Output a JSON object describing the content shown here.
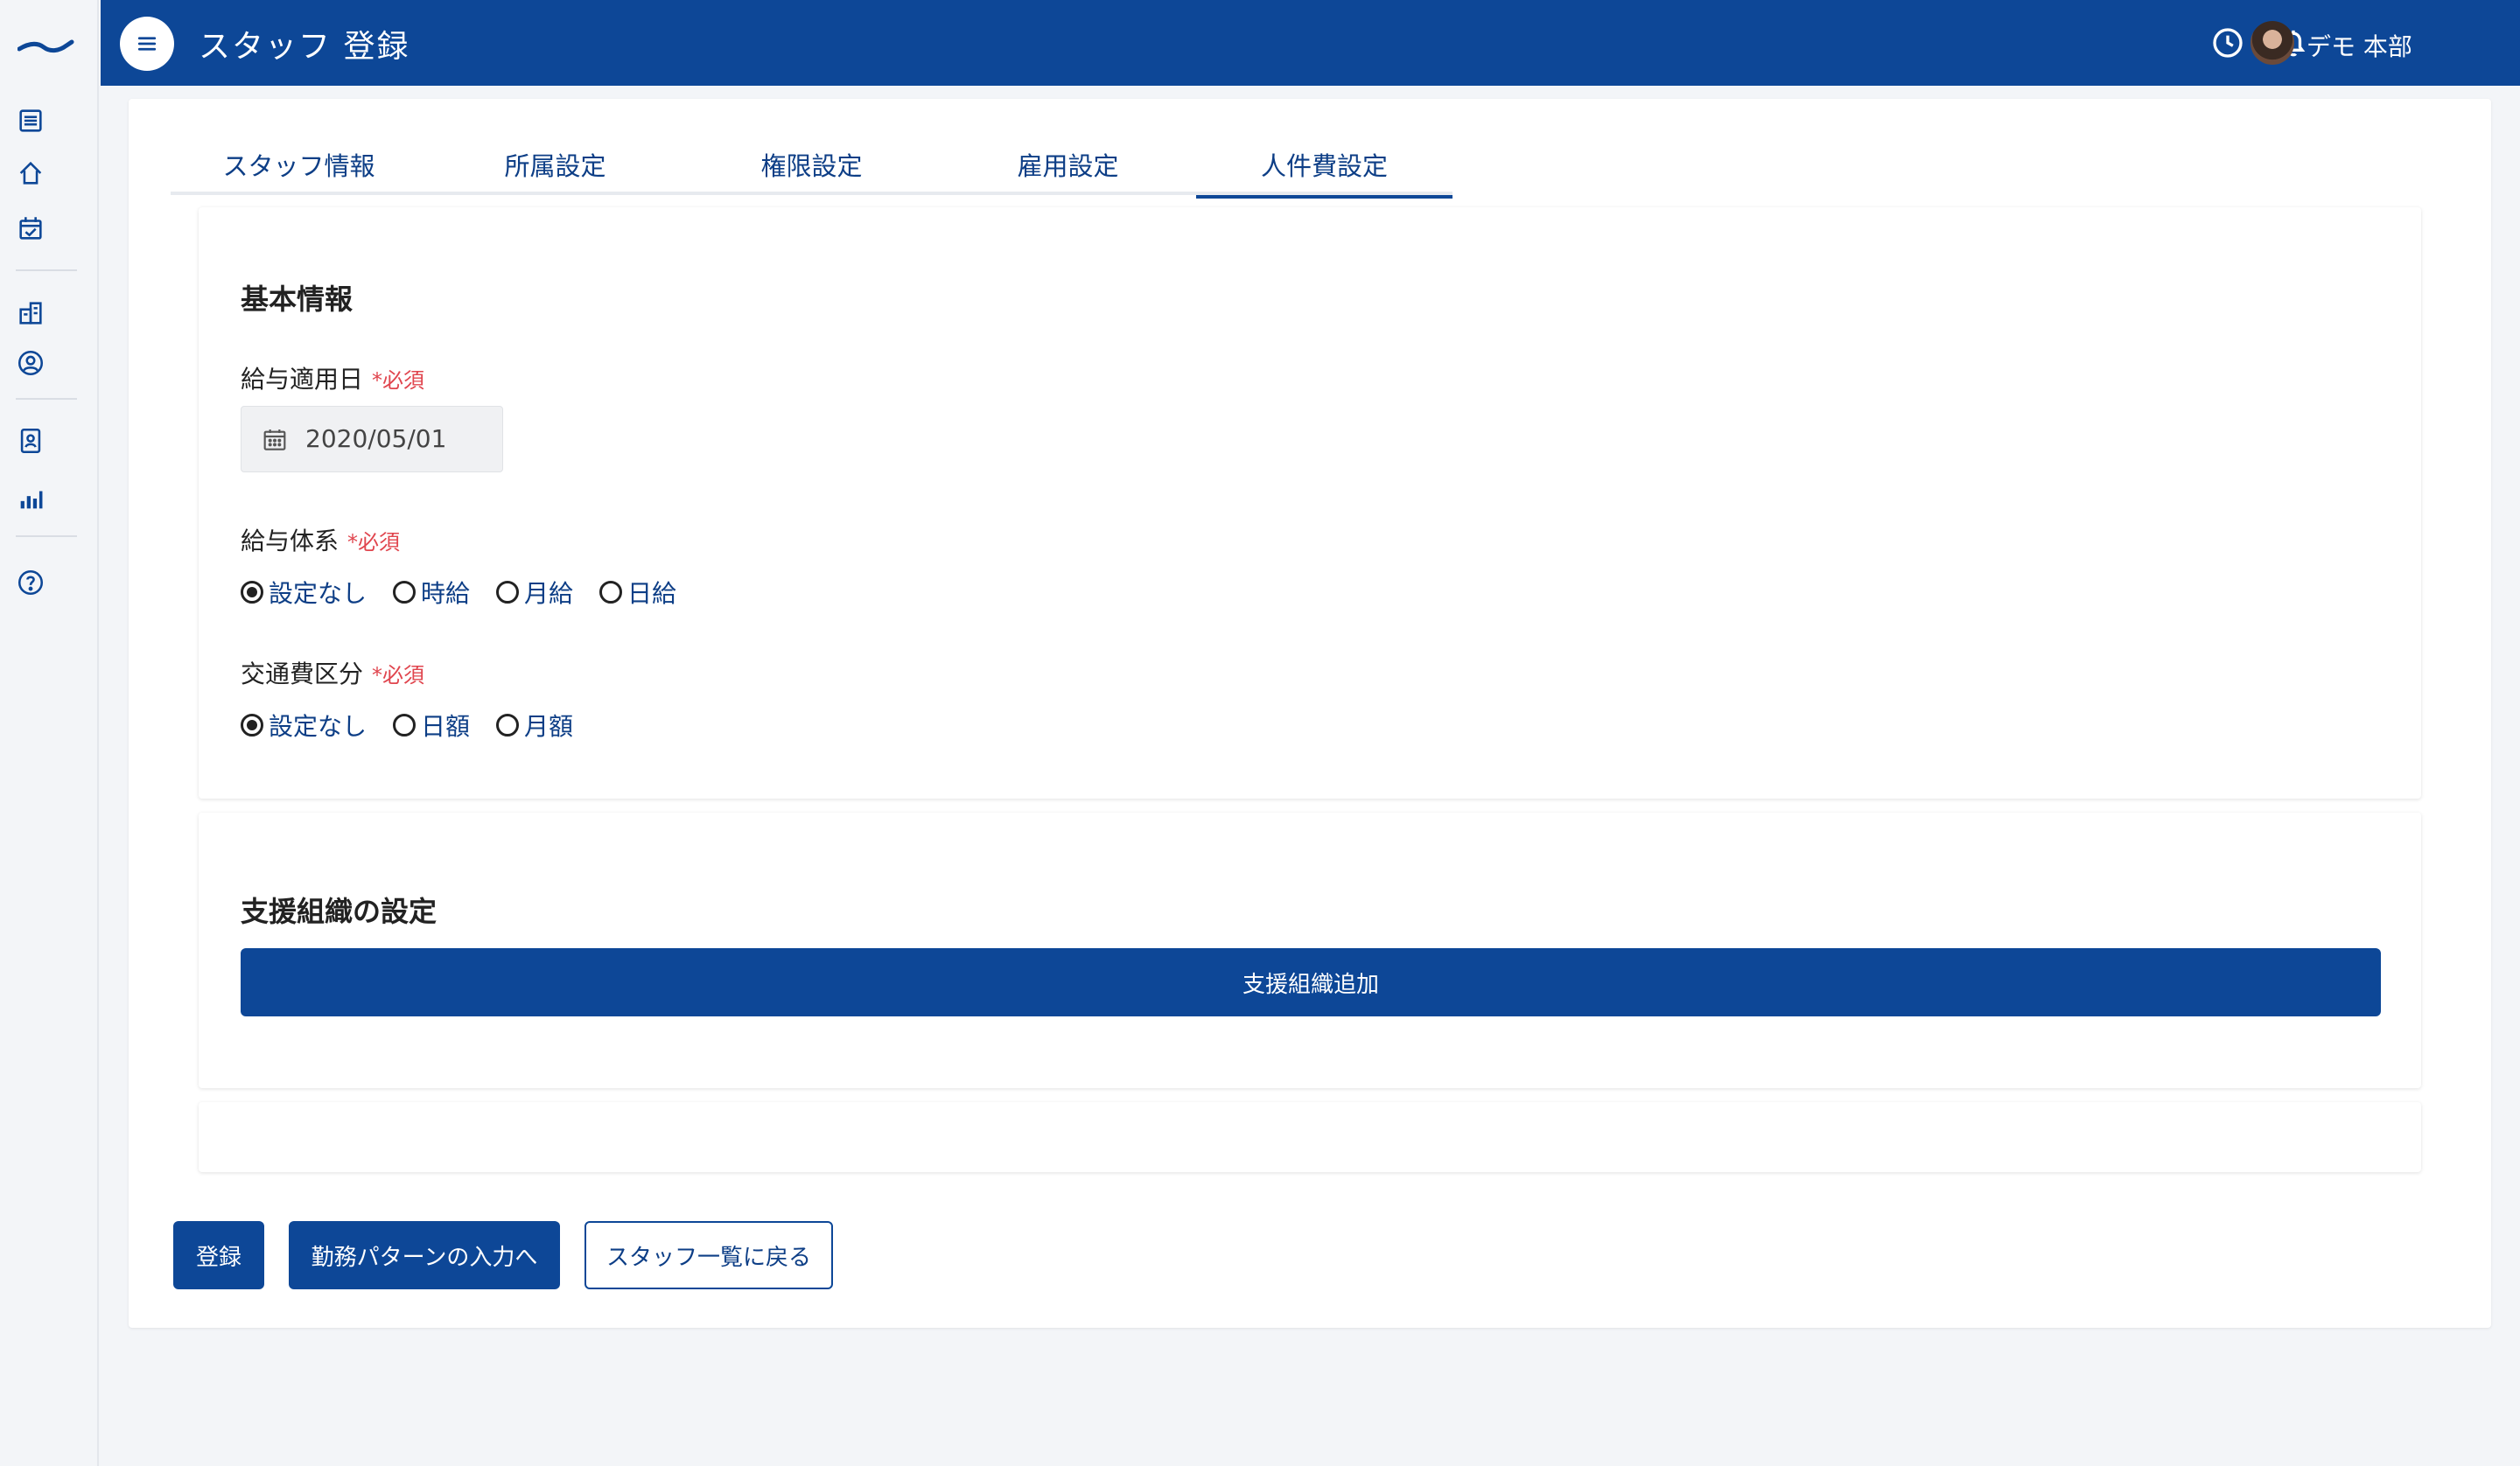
{
  "header": {
    "title": "スタッフ 登録",
    "user_name": "デモ 本部"
  },
  "sidebar": {
    "icons": [
      "list-icon",
      "home-icon",
      "calendar-check-icon",
      "building-icon",
      "user-circle-icon",
      "id-card-icon",
      "bar-chart-icon",
      "help-icon"
    ]
  },
  "tabs": [
    {
      "label": "スタッフ情報",
      "active": false
    },
    {
      "label": "所属設定",
      "active": false
    },
    {
      "label": "権限設定",
      "active": false
    },
    {
      "label": "雇用設定",
      "active": false
    },
    {
      "label": "人件費設定",
      "active": true
    }
  ],
  "basic": {
    "title": "基本情報",
    "salary_date_label": "給与適用日",
    "required": "*必須",
    "salary_date_value": "2020/05/01",
    "pay_system_label": "給与体系",
    "pay_system_options": [
      "設定なし",
      "時給",
      "月給",
      "日給"
    ],
    "pay_system_selected": "設定なし",
    "transport_label": "交通費区分",
    "transport_options": [
      "設定なし",
      "日額",
      "月額"
    ],
    "transport_selected": "設定なし"
  },
  "support": {
    "title": "支援組織の設定",
    "add_button": "支援組織追加"
  },
  "actions": {
    "register": "登録",
    "work_pattern": "勤務パターンの入力へ",
    "back": "スタッフ一覧に戻る"
  },
  "colors": {
    "brand": "#0d4797",
    "required": "#e0454e"
  }
}
